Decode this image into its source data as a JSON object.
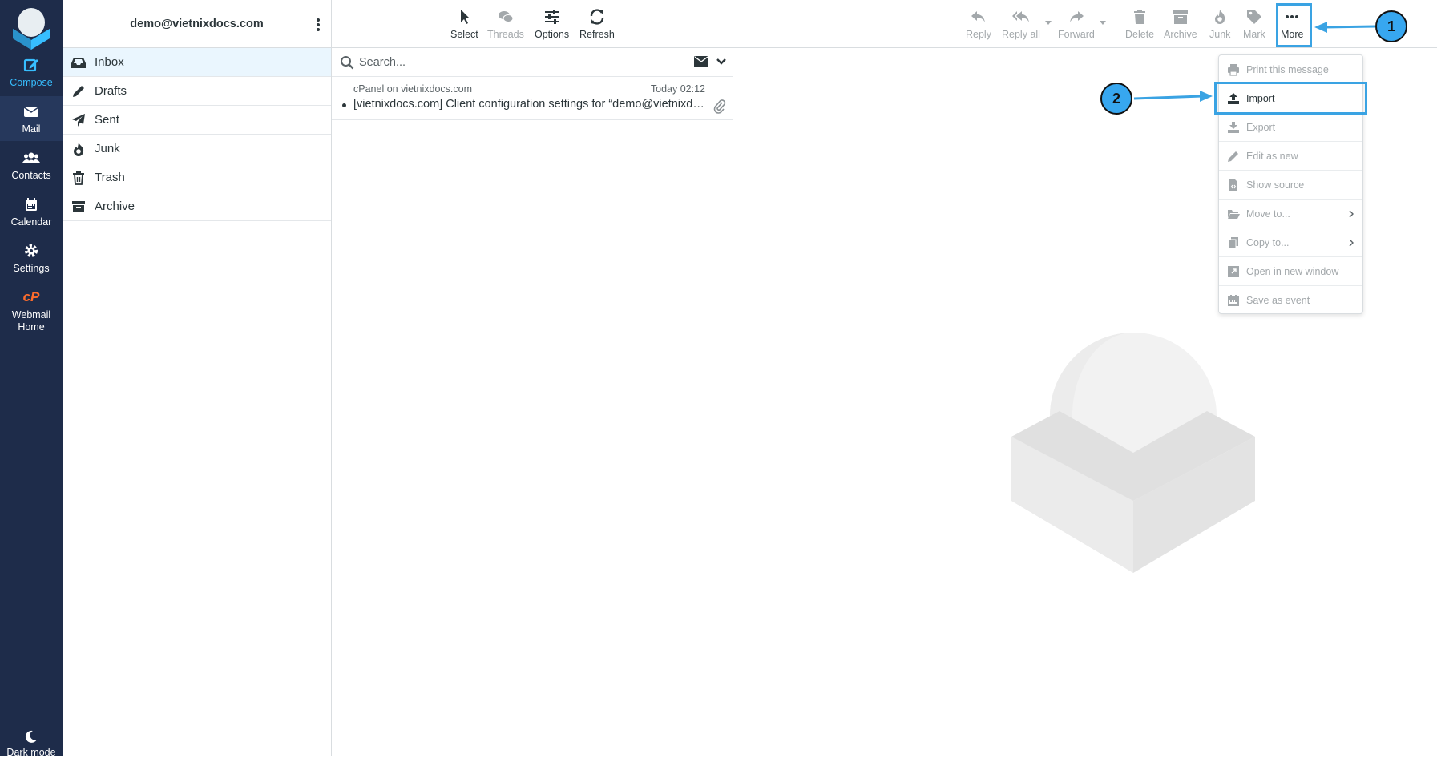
{
  "nav": {
    "compose": "Compose",
    "mail": "Mail",
    "contacts": "Contacts",
    "calendar": "Calendar",
    "settings": "Settings",
    "webmail_home": [
      "Webmail",
      "Home"
    ],
    "dark_mode": "Dark mode"
  },
  "account": {
    "email": "demo@vietnixdocs.com"
  },
  "folders": [
    {
      "label": "Inbox",
      "icon": "inbox-icon"
    },
    {
      "label": "Drafts",
      "icon": "pencil-icon"
    },
    {
      "label": "Sent",
      "icon": "paper-plane-icon"
    },
    {
      "label": "Junk",
      "icon": "fire-icon"
    },
    {
      "label": "Trash",
      "icon": "trash-icon"
    },
    {
      "label": "Archive",
      "icon": "archive-icon"
    }
  ],
  "list_toolbar": {
    "select": "Select",
    "threads": "Threads",
    "options": "Options",
    "refresh": "Refresh"
  },
  "search": {
    "placeholder": "Search..."
  },
  "messages": [
    {
      "from": "cPanel on vietnixdocs.com",
      "date": "Today 02:12",
      "subject": "[vietnixdocs.com] Client configuration settings for “demo@vietnixdocs.com”"
    }
  ],
  "content_toolbar": {
    "reply": "Reply",
    "reply_all": "Reply all",
    "forward": "Forward",
    "delete": "Delete",
    "archive": "Archive",
    "junk": "Junk",
    "mark": "Mark",
    "more": "More"
  },
  "more_menu": {
    "print": "Print this message",
    "import": "Import",
    "export": "Export",
    "edit_as_new": "Edit as new",
    "show_source": "Show source",
    "move_to": "Move to...",
    "copy_to": "Copy to...",
    "open_new_window": "Open in new window",
    "save_as_event": "Save as event"
  },
  "callouts": {
    "one": "1",
    "two": "2"
  },
  "colors": {
    "nav_bg": "#1e2c4a",
    "accent": "#37beff",
    "highlight": "#3aa3e3",
    "webmail_orange": "#ff6c2c"
  }
}
